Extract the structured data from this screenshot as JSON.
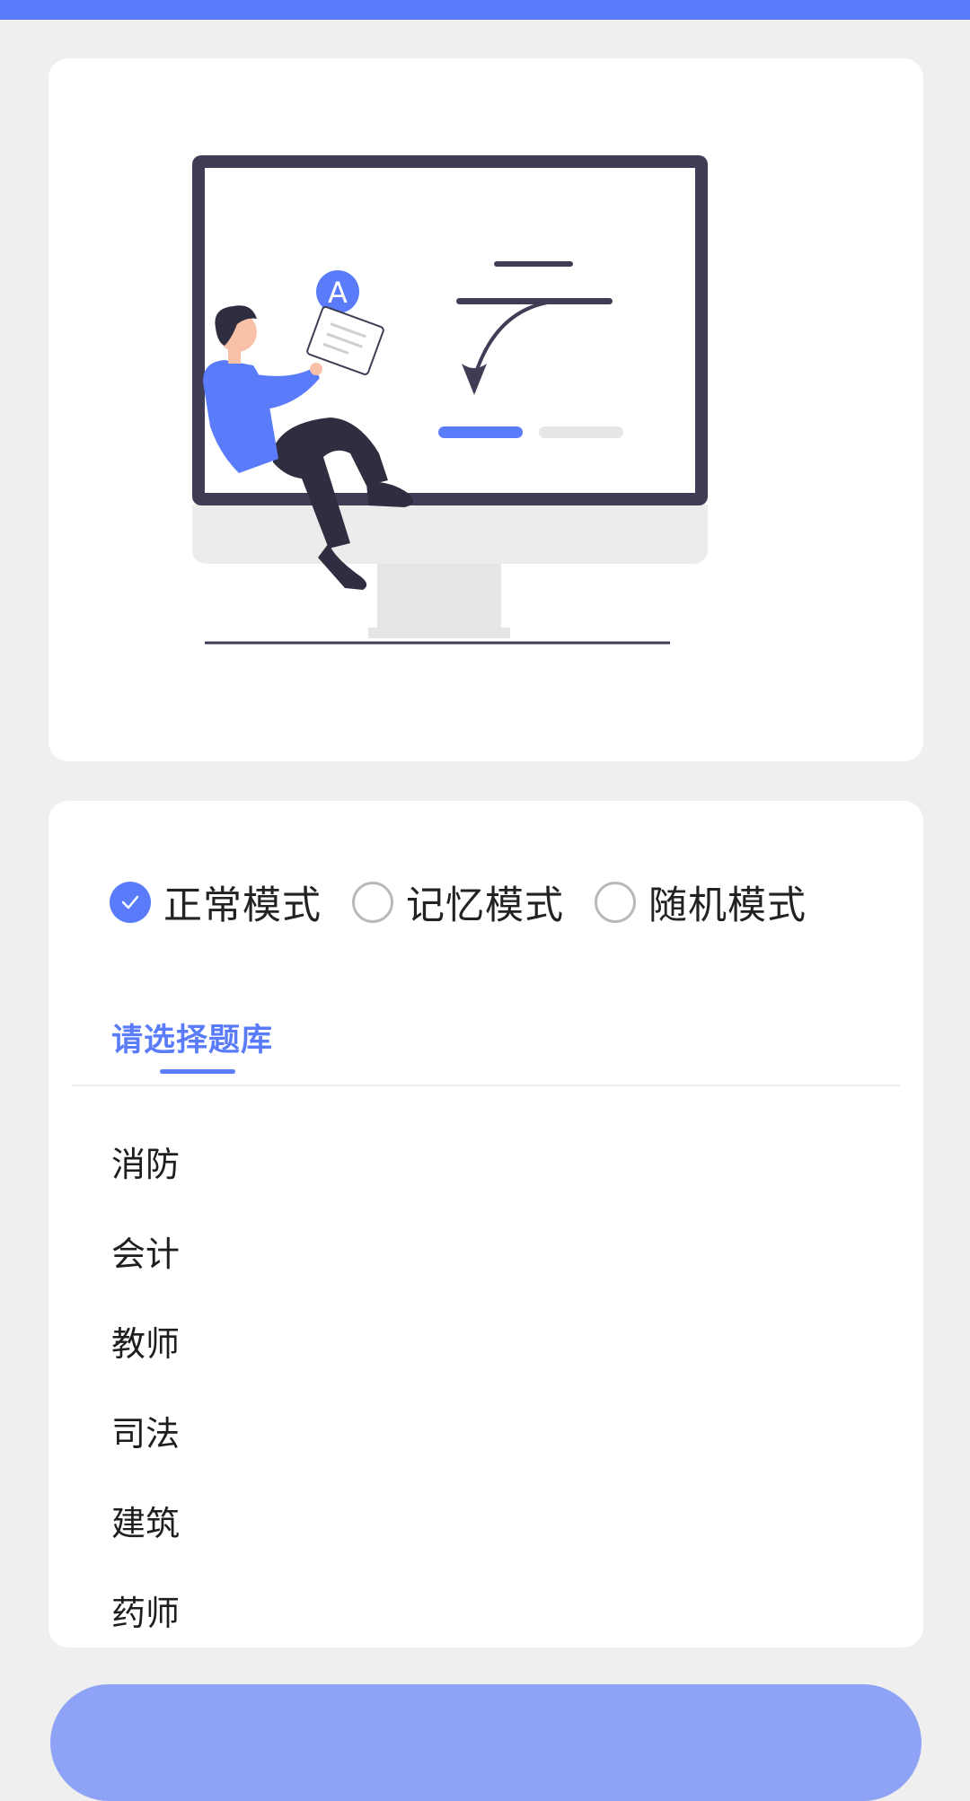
{
  "colors": {
    "accent": "#5b7cfa",
    "start_button": "#8ea3f6",
    "background": "#efefef",
    "card": "#ffffff"
  },
  "hero": {
    "illustration": "person-sitting-on-monitor-illustration",
    "badge_letter": "A"
  },
  "modes": {
    "selected": "正常模式",
    "options": [
      {
        "label": "正常模式",
        "checked": true
      },
      {
        "label": "记忆模式",
        "checked": false
      },
      {
        "label": "随机模式",
        "checked": false
      }
    ]
  },
  "tab": {
    "label": "请选择题库"
  },
  "banks": [
    "消防",
    "会计",
    "教师",
    "司法",
    "建筑",
    "药师"
  ]
}
